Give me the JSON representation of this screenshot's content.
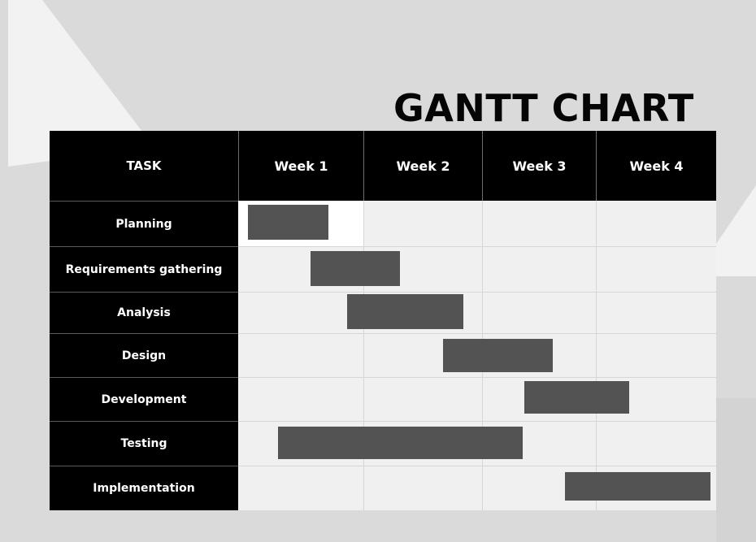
{
  "title": "GANTT CHART",
  "header": {
    "task_label": "TASK",
    "weeks": [
      "Week 1",
      "Week 2",
      "Week 3",
      "Week 4"
    ]
  },
  "colors": {
    "background": "#dadada",
    "header_fill": "#000000",
    "grid_fill": "#f0f0f0",
    "bar_fill": "#535353"
  },
  "chart_data": {
    "type": "gantt",
    "title": "GANTT CHART",
    "unit": "weeks",
    "columns": [
      "Week 1",
      "Week 2",
      "Week 3",
      "Week 4"
    ],
    "tasks": [
      {
        "name": "Planning",
        "start": 0.08,
        "end": 0.72
      },
      {
        "name": "Requirements gathering",
        "start": 0.58,
        "end": 1.31
      },
      {
        "name": "Analysis",
        "start": 0.87,
        "end": 1.84
      },
      {
        "name": "Design",
        "start": 1.67,
        "end": 2.62
      },
      {
        "name": "Development",
        "start": 2.37,
        "end": 3.28
      },
      {
        "name": "Testing",
        "start": 0.32,
        "end": 2.36
      },
      {
        "name": "Implementation",
        "start": 2.73,
        "end": 3.95
      }
    ]
  }
}
